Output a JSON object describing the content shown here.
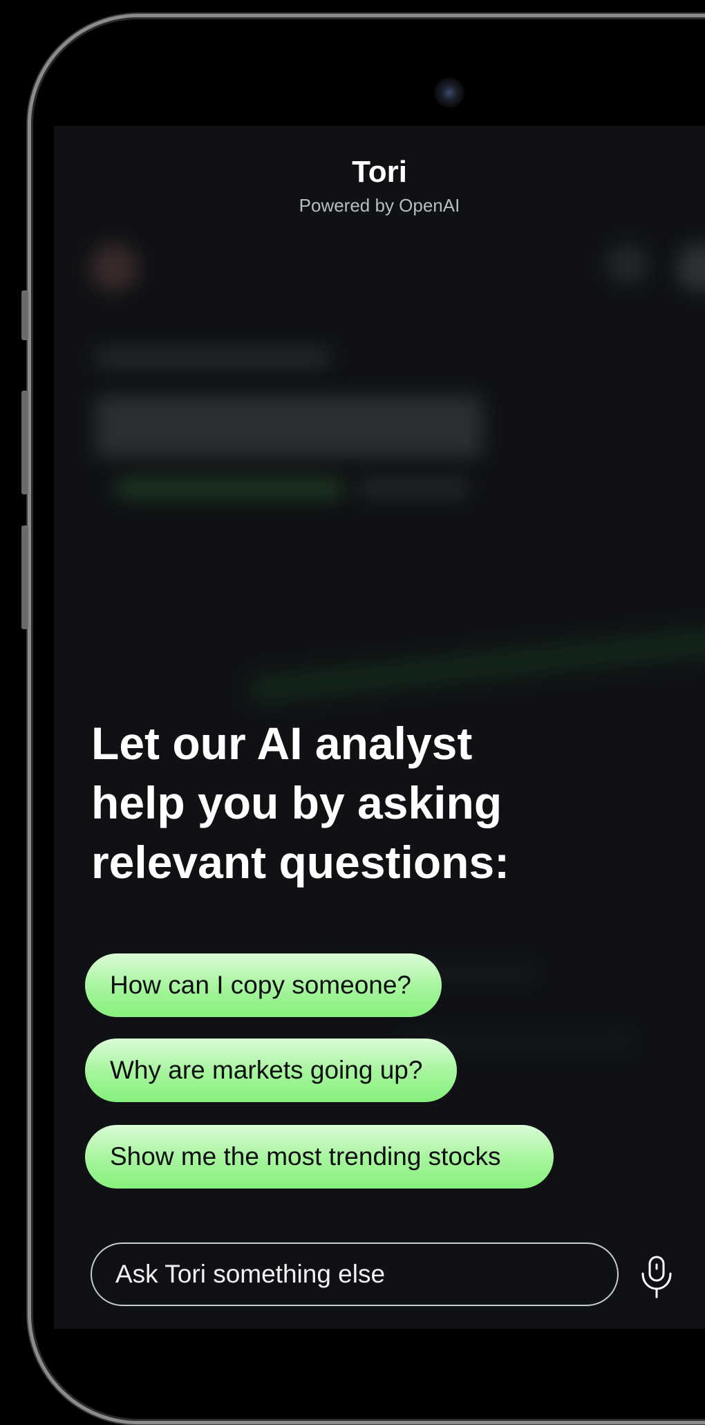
{
  "header": {
    "title": "Tori",
    "subtitle": "Powered by OpenAI"
  },
  "main": {
    "headline_lines": [
      "Let our AI analyst",
      "help you by asking",
      "relevant questions:"
    ],
    "suggestions": [
      "How can I copy someone?",
      "Why are markets going up?",
      "Show me the most trending stocks"
    ]
  },
  "composer": {
    "placeholder": "Ask Tori something else",
    "mic_icon": "microphone-icon"
  },
  "colors": {
    "screen_background": "#0f1114",
    "suggestion_gradient_top": "#dcfbd8",
    "suggestion_gradient_bottom": "#86f07c",
    "text_primary": "#ffffff",
    "text_secondary": "#b9bcc2"
  }
}
